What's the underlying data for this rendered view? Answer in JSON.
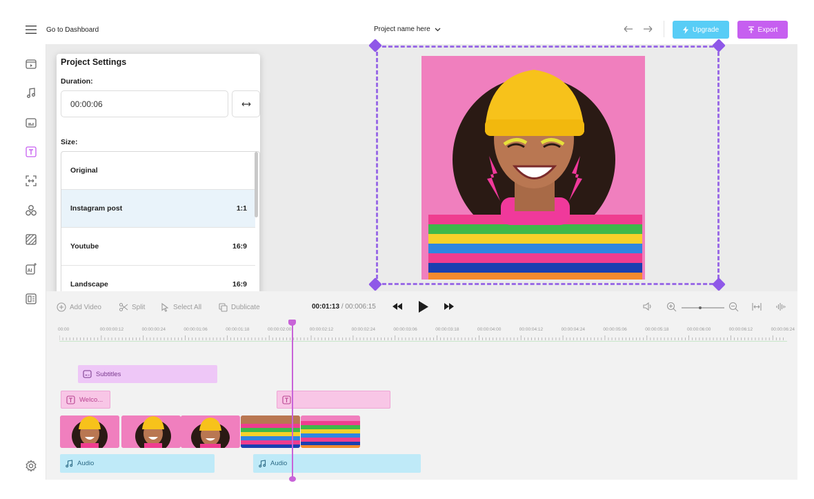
{
  "header": {
    "dashboard_link": "Go to Dashboard",
    "project_name": "Project name here",
    "upgrade_label": "Upgrade",
    "export_label": "Export"
  },
  "rail": {
    "icons": [
      "video-icon",
      "music-icon",
      "subtitles-icon",
      "text-icon",
      "resize-icon",
      "elements-icon",
      "transitions-icon",
      "ai-icon",
      "templates-icon",
      "settings-icon"
    ],
    "active": "text-icon"
  },
  "project_settings": {
    "title": "Project Settings",
    "duration_label": "Duration:",
    "duration_value": "00:00:06",
    "size_label": "Size:",
    "sizes": [
      {
        "name": "Original",
        "ratio": ""
      },
      {
        "name": "Instagram post",
        "ratio": "1:1"
      },
      {
        "name": "Youtube",
        "ratio": "16:9"
      },
      {
        "name": "Landscape",
        "ratio": "16:9"
      }
    ],
    "selected_size": "Instagram post"
  },
  "toolbar": {
    "add_video": "Add Video",
    "split": "Split",
    "select_all": "Select All",
    "duplicate": "Dublicate",
    "current_time": "00:01:13",
    "separator": "/",
    "total_time": "00:006:15"
  },
  "timeline": {
    "ruler": [
      "00:00",
      "00:00:00:12",
      "00:00:00:24",
      "00:00:01:06",
      "00:00:01:18",
      "00:00:02:00",
      "00:00:02:12",
      "00:00:02:24",
      "00:00:03:06",
      "00:00:03:18",
      "00:00:04:00",
      "00:00:04:12",
      "00:00:04:24",
      "00:00:05:06",
      "00:00:05:18",
      "00:00:06:00",
      "00:00:06:12",
      "00:00:06:24"
    ],
    "subtitles_clip": "Subtitles",
    "text_clip": "Welco...",
    "audio_clips": [
      "Audio",
      "Audio"
    ],
    "video_thumbnails": 5
  },
  "colors": {
    "accent_purple": "#c65ff0",
    "upgrade_blue": "#58cdf6",
    "selection_dash": "#9a6be6",
    "canvas_bg": "#ebebeb",
    "photo_bg": "#f07fbe"
  }
}
